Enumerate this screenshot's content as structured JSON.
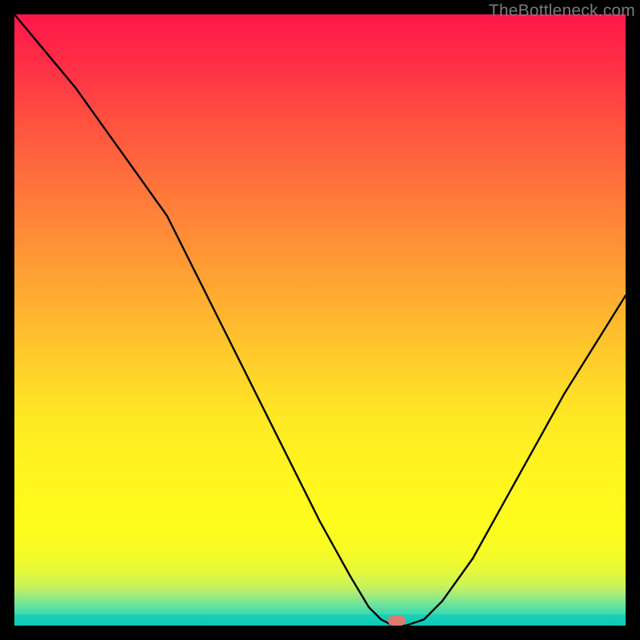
{
  "watermark": "TheBottleneck.com",
  "marker": {
    "x_pct": 62.5,
    "y_pct": 99.2
  },
  "chart_data": {
    "type": "line",
    "title": "",
    "xlabel": "",
    "ylabel": "",
    "xlim": [
      0,
      100
    ],
    "ylim": [
      0,
      100
    ],
    "grid": false,
    "legend": false,
    "series": [
      {
        "name": "bottleneck-curve",
        "x": [
          0,
          5,
          10,
          15,
          20,
          25,
          30,
          35,
          40,
          45,
          50,
          55,
          58,
          60,
          62,
          64,
          67,
          70,
          75,
          80,
          85,
          90,
          95,
          100
        ],
        "y": [
          100,
          94,
          88,
          81,
          74,
          67,
          57,
          47,
          37,
          27,
          17,
          8,
          3,
          1,
          0,
          0,
          1,
          4,
          11,
          20,
          29,
          38,
          46,
          54
        ]
      }
    ],
    "marker_point": {
      "x": 62.5,
      "y": 0
    },
    "background_gradient": {
      "top": "#ff1749",
      "mid1": "#ffa233",
      "mid2": "#fff41f",
      "bottom": "#0acbb6"
    }
  }
}
